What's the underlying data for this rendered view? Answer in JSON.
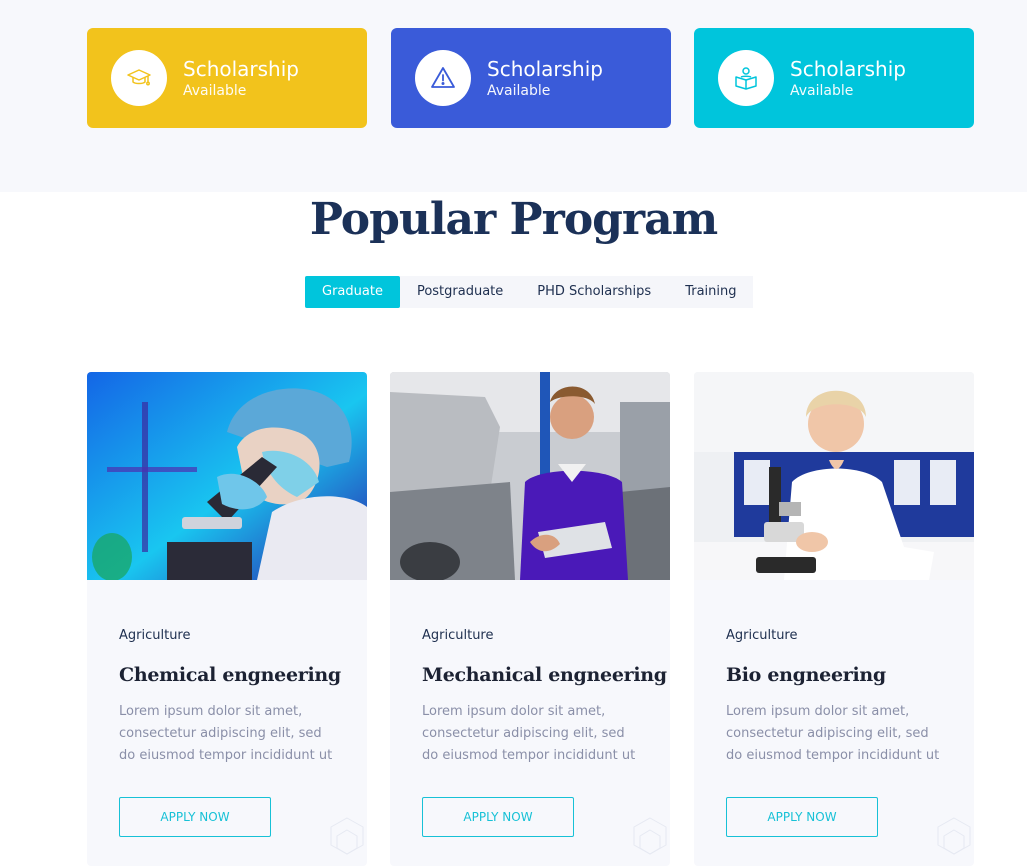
{
  "colors": {
    "yellow": "#f2c31c",
    "blue": "#3a5bd9",
    "cyan": "#00c5dc",
    "title": "#1b3158",
    "accent": "#17c1d6"
  },
  "features": [
    {
      "title": "Scholarship",
      "subtitle": "Available",
      "icon": "graduation-cap-icon"
    },
    {
      "title": "Scholarship",
      "subtitle": "Available",
      "icon": "warning-triangle-icon"
    },
    {
      "title": "Scholarship",
      "subtitle": "Available",
      "icon": "reading-person-icon"
    }
  ],
  "section": {
    "title": "Popular Program"
  },
  "tabs": [
    "Graduate",
    "Postgraduate",
    "PHD Scholarships",
    "Training"
  ],
  "active_tab": "Graduate",
  "cards": [
    {
      "category": "Agriculture",
      "title": "Chemical engneering",
      "description": "Lorem ipsum dolor sit amet, consectetur adipiscing elit, sed do eiusmod tempor incididunt ut",
      "button": "APPLY NOW",
      "photo": "scientist-with-microscope-photo"
    },
    {
      "category": "Agriculture",
      "title": "Mechanical engneering",
      "description": "Lorem ipsum dolor sit amet, consectetur adipiscing elit, sed do eiusmod tempor incididunt ut",
      "button": "APPLY NOW",
      "photo": "mechanic-with-clipboard-photo"
    },
    {
      "category": "Agriculture",
      "title": "Bio engneering",
      "description": "Lorem ipsum dolor sit amet, consectetur adipiscing elit, sed do eiusmod tempor incididunt ut",
      "button": "APPLY NOW",
      "photo": "woman-with-microscope-photo"
    }
  ]
}
